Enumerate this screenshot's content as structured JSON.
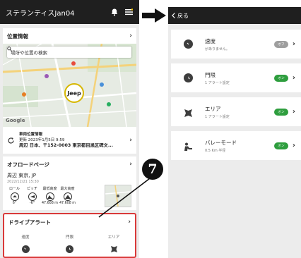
{
  "left": {
    "app_title": "ステランティスJan04",
    "location": {
      "section_title": "位置情報",
      "search_placeholder": "場所や位置の検索",
      "map_badge": "Jeep",
      "map_credit": "Google",
      "vehicle_pos_title": "車両位置情報",
      "vehicle_pos_updated": "更新 2023年1月5日 9:59",
      "vehicle_pos_address": "周辺 日本、〒152-0003 東京都目黒区碑文..."
    },
    "offroad": {
      "section_title": "オフロードページ",
      "location": "周辺 東京, JP",
      "date": "2022/12/21 15:30",
      "gauges": [
        {
          "label": "ロール",
          "value": "6°"
        },
        {
          "label": "ピッチ",
          "value": "-6°"
        },
        {
          "label": "最低高度",
          "value": "47.608 m"
        },
        {
          "label": "最大高度",
          "value": "47.608 m"
        }
      ]
    },
    "drive_alert": {
      "section_title": "ドライブアラート",
      "items": [
        "速度",
        "門限",
        "エリア"
      ]
    }
  },
  "callout_number": "7",
  "right": {
    "back_label": "戻る",
    "rows": [
      {
        "title": "速度",
        "subtitle": "がありません。",
        "toggle": "オフ",
        "toggle_color": "#9e9e9e"
      },
      {
        "title": "門限",
        "subtitle": "1 アラート設定",
        "toggle": "オン",
        "toggle_color": "#2e9e3e"
      },
      {
        "title": "エリア",
        "subtitle": "1 アラート設定",
        "toggle": "オン",
        "toggle_color": "#2e9e3e"
      },
      {
        "title": "バレーモード",
        "subtitle": "0.5 Km 半径",
        "toggle": "オン",
        "toggle_color": "#2e9e3e"
      }
    ]
  },
  "colors": {
    "topbar": "#1f1f1f",
    "highlight_border": "#d93a3a",
    "toggle_on": "#2e9e3e",
    "toggle_off": "#9e9e9e"
  }
}
